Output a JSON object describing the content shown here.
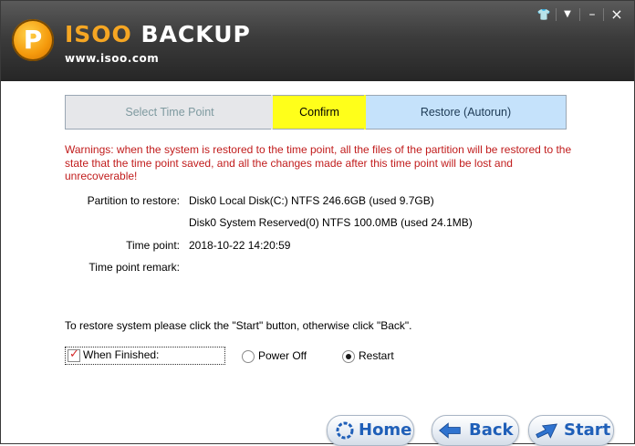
{
  "app": {
    "brand_prefix": "ISOO",
    "brand_suffix": "BACKUP",
    "url": "www.isoo.com",
    "logo_letter": "P"
  },
  "window_controls": [
    {
      "icon": "shirt-icon",
      "glyph": "👕"
    },
    {
      "icon": "menu-icon",
      "glyph": "▼"
    },
    {
      "icon": "minimize-icon",
      "glyph": "–"
    },
    {
      "icon": "close-icon",
      "glyph": "×"
    }
  ],
  "steps": [
    {
      "label": "Select Time Point",
      "state": "done"
    },
    {
      "label": "Confirm",
      "state": "active"
    },
    {
      "label": "Restore (Autorun)",
      "state": "pending"
    }
  ],
  "warning": "Warnings: when the system is restored to the time point, all the files of the partition will be restored to the state that the time point saved, and all the changes made after this time point will be lost and unrecoverable!",
  "details": {
    "partition_label": "Partition to restore:",
    "partitions": [
      "Disk0  Local Disk(C:) NTFS 246.6GB (used 9.7GB)",
      "Disk0  System Reserved(0) NTFS 100.0MB (used 24.1MB)"
    ],
    "time_point_label": "Time point:",
    "time_point_value": "2018-10-22 14:20:59",
    "remark_label": "Time point remark:",
    "remark_value": ""
  },
  "instruction": "To restore system please click the \"Start\" button, otherwise click \"Back\".",
  "when_finished": {
    "label": "When Finished:",
    "checked": true,
    "options": [
      "Power Off",
      "Restart"
    ],
    "selected": "Restart"
  },
  "buttons": {
    "home": "Home",
    "back": "Back",
    "start": "Start"
  },
  "colors": {
    "warning": "#c11c1c",
    "active_step": "#ffff1a",
    "pending_step": "#c5e2fb",
    "button_text": "#1f5fb8",
    "brand_accent": "#f5a623"
  }
}
